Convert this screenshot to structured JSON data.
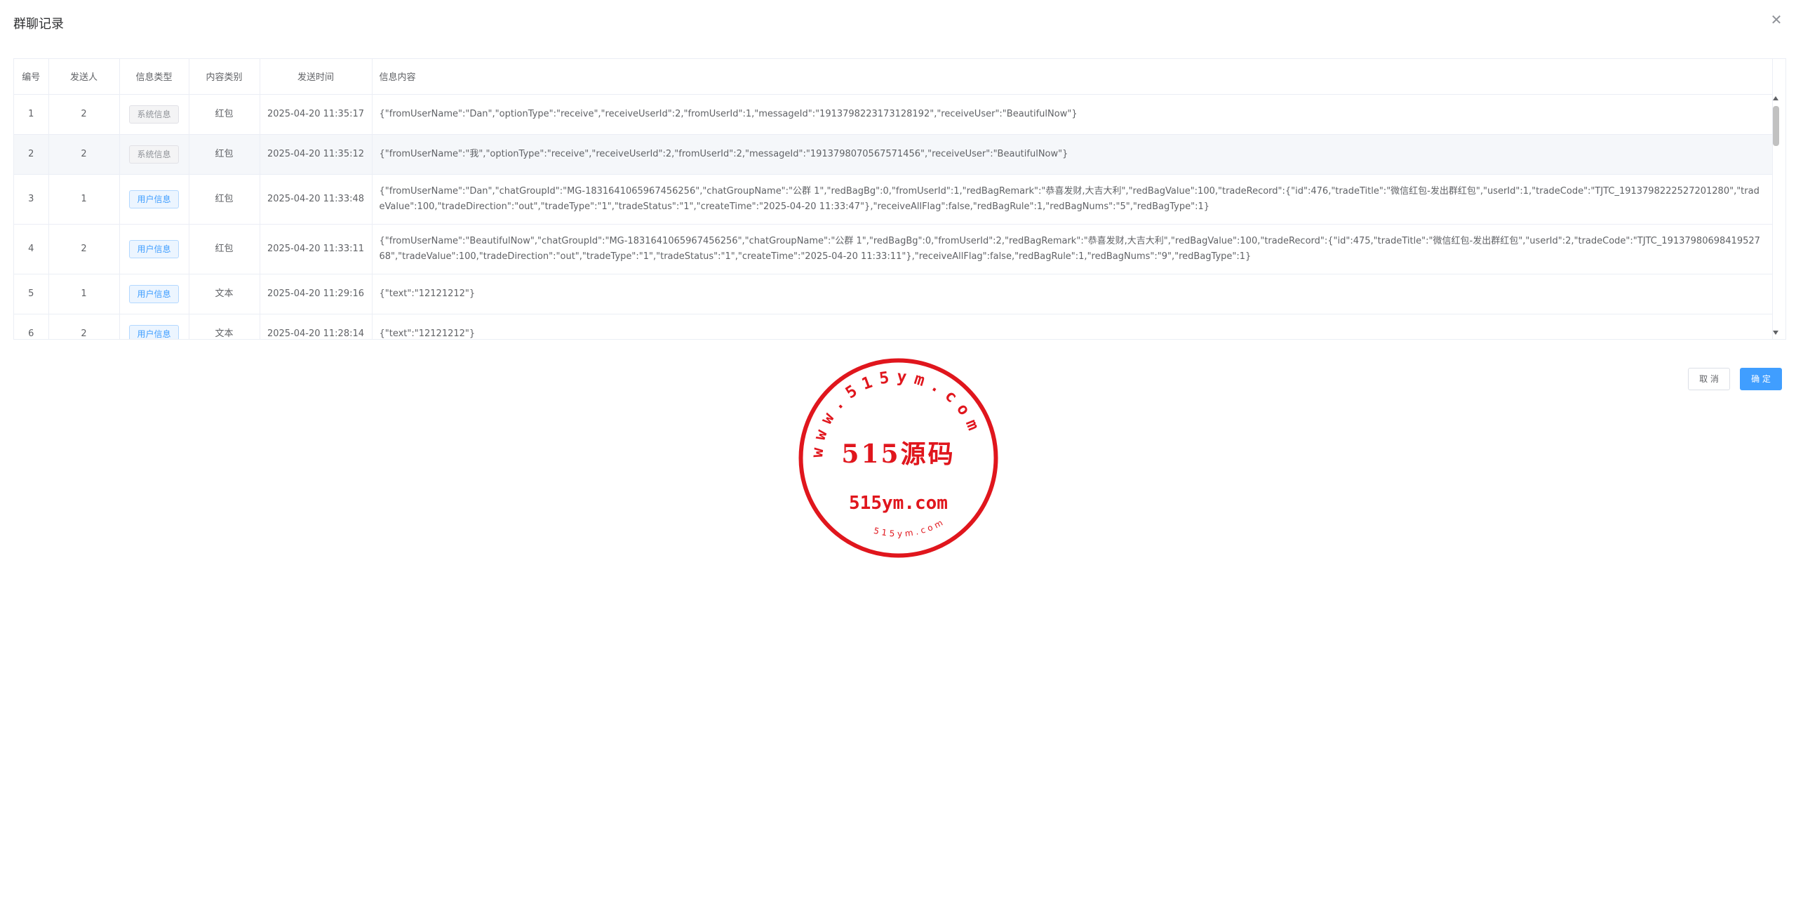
{
  "dialog": {
    "title": "群聊记录",
    "close_icon": "close-icon"
  },
  "table": {
    "columns": [
      "编号",
      "发送人",
      "信息类型",
      "内容类别",
      "发送时间",
      "信息内容"
    ],
    "rows": [
      {
        "id": "1",
        "sender": "2",
        "msg_type": "系统信息",
        "msg_type_style": "info",
        "category": "红包",
        "time": "2025-04-20 11:35:17",
        "content": "{\"fromUserName\":\"Dan\",\"optionType\":\"receive\",\"receiveUserId\":2,\"fromUserId\":1,\"messageId\":\"1913798223173128192\",\"receiveUser\":\"BeautifulNow\"}"
      },
      {
        "id": "2",
        "sender": "2",
        "msg_type": "系统信息",
        "msg_type_style": "info",
        "category": "红包",
        "time": "2025-04-20 11:35:12",
        "content": "{\"fromUserName\":\"我\",\"optionType\":\"receive\",\"receiveUserId\":2,\"fromUserId\":2,\"messageId\":\"1913798070567571456\",\"receiveUser\":\"BeautifulNow\"}"
      },
      {
        "id": "3",
        "sender": "1",
        "msg_type": "用户信息",
        "msg_type_style": "primary",
        "category": "红包",
        "time": "2025-04-20 11:33:48",
        "content": "{\"fromUserName\":\"Dan\",\"chatGroupId\":\"MG-1831641065967456256\",\"chatGroupName\":\"公群 1\",\"redBagBg\":0,\"fromUserId\":1,\"redBagRemark\":\"恭喜发财,大吉大利\",\"redBagValue\":100,\"tradeRecord\":{\"id\":476,\"tradeTitle\":\"微信红包-发出群红包\",\"userId\":1,\"tradeCode\":\"TJTC_1913798222527201280\",\"tradeValue\":100,\"tradeDirection\":\"out\",\"tradeType\":\"1\",\"tradeStatus\":\"1\",\"createTime\":\"2025-04-20 11:33:47\"},\"receiveAllFlag\":false,\"redBagRule\":1,\"redBagNums\":\"5\",\"redBagType\":1}"
      },
      {
        "id": "4",
        "sender": "2",
        "msg_type": "用户信息",
        "msg_type_style": "primary",
        "category": "红包",
        "time": "2025-04-20 11:33:11",
        "content": "{\"fromUserName\":\"BeautifulNow\",\"chatGroupId\":\"MG-1831641065967456256\",\"chatGroupName\":\"公群 1\",\"redBagBg\":0,\"fromUserId\":2,\"redBagRemark\":\"恭喜发财,大吉大利\",\"redBagValue\":100,\"tradeRecord\":{\"id\":475,\"tradeTitle\":\"微信红包-发出群红包\",\"userId\":2,\"tradeCode\":\"TJTC_1913798069841952768\",\"tradeValue\":100,\"tradeDirection\":\"out\",\"tradeType\":\"1\",\"tradeStatus\":\"1\",\"createTime\":\"2025-04-20 11:33:11\"},\"receiveAllFlag\":false,\"redBagRule\":1,\"redBagNums\":\"9\",\"redBagType\":1}"
      },
      {
        "id": "5",
        "sender": "1",
        "msg_type": "用户信息",
        "msg_type_style": "primary",
        "category": "文本",
        "time": "2025-04-20 11:29:16",
        "content": "{\"text\":\"12121212\"}"
      },
      {
        "id": "6",
        "sender": "2",
        "msg_type": "用户信息",
        "msg_type_style": "primary",
        "category": "文本",
        "time": "2025-04-20 11:28:14",
        "content": "{\"text\":\"12121212\"}"
      }
    ]
  },
  "footer": {
    "cancel_label": "取 消",
    "ok_label": "确 定"
  },
  "watermark": {
    "ring_text": "www.515ym.com",
    "center_text": "515源码",
    "url_text": "515ym.com",
    "small_text": "515ym.com",
    "color": "#e0161d"
  },
  "colors": {
    "primary": "#409eff",
    "border": "#ebeef5",
    "stripe": "#f5f7fa",
    "text": "#606266"
  }
}
